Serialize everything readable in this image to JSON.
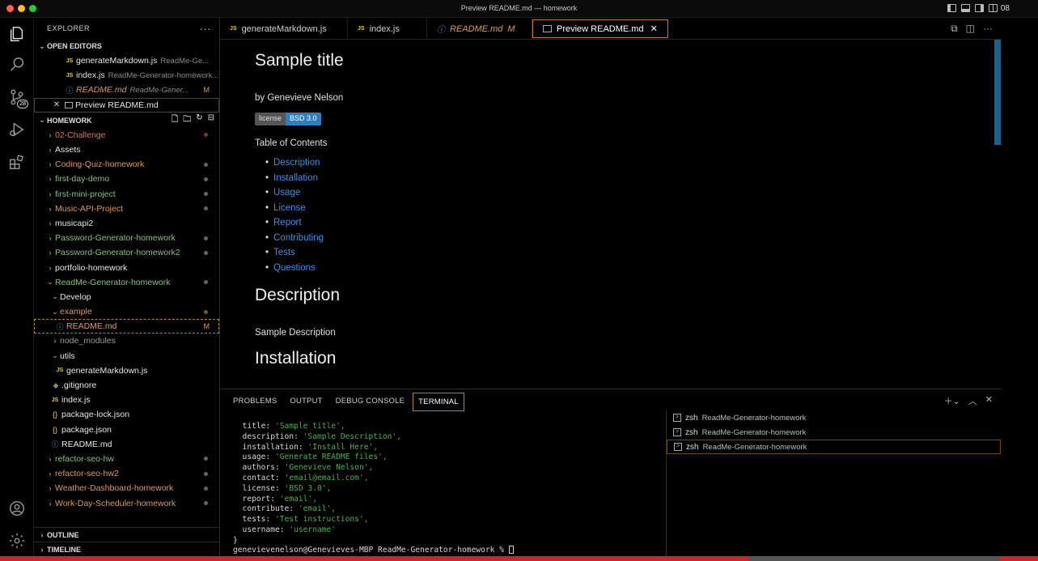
{
  "window": {
    "title": "Preview README.md — homework",
    "badge": "08"
  },
  "activity": {
    "scm_badge": "28"
  },
  "sidebar": {
    "header": "EXPLORER",
    "more": "···",
    "open_editors_label": "OPEN EDITORS",
    "open_editors": [
      {
        "name": "generateMarkdown.js",
        "desc": "ReadMe-Ge..."
      },
      {
        "name": "index.js",
        "desc": "ReadMe-Generator-homework..."
      },
      {
        "name": "README.md",
        "desc": "ReadMe-Gener...",
        "mod": "M"
      },
      {
        "name": "Preview README.md",
        "desc": ""
      }
    ],
    "workspace_label": "HOMEWORK",
    "tree": [
      "02-Challenge",
      "Assets",
      "Coding-Quiz-homework",
      "first-day-demo",
      "first-mini-project",
      "Music-API-Project",
      "musicapi2",
      "Password-Generator-homework",
      "Password-Generator-homework2",
      "portfolio-homework",
      "ReadMe-Generator-homework",
      "Develop",
      "example",
      "README.md",
      "node_modules",
      "utils",
      "generateMarkdown.js",
      ".gitignore",
      "index.js",
      "package-lock.json",
      "package.json",
      "README.md",
      "refactor-seo-hw",
      "refactor-seo-hw2",
      "Weather-Dashboard-homework",
      "Work-Day-Scheduler-homework"
    ],
    "readme_mod": "M",
    "outline_label": "OUTLINE",
    "timeline_label": "TIMELINE"
  },
  "tabs": [
    {
      "label": "generateMarkdown.js"
    },
    {
      "label": "index.js"
    },
    {
      "label": "README.md",
      "mod": "M"
    },
    {
      "label": "Preview README.md",
      "close": "✕"
    }
  ],
  "preview": {
    "title": "Sample title",
    "author": "by Genevieve Nelson",
    "badge_left": "license",
    "badge_right": "BSD 3.0",
    "toc_heading": "Table of Contents",
    "toc": [
      "Description",
      "Installation",
      "Usage",
      "License",
      "Report",
      "Contributing",
      "Tests",
      "Questions"
    ],
    "h_description": "Description",
    "p_description": "Sample Description",
    "h_installation": "Installation"
  },
  "panel": {
    "tabs": [
      "PROBLEMS",
      "OUTPUT",
      "DEBUG CONSOLE",
      "TERMINAL"
    ],
    "terminal_lines": [
      {
        "key": "  title: ",
        "val": "'Sample title',"
      },
      {
        "key": "  description: ",
        "val": "'Sample Description',"
      },
      {
        "key": "  installation: ",
        "val": "'Install Here',"
      },
      {
        "key": "  usage: ",
        "val": "'Generate README files',"
      },
      {
        "key": "  authors: ",
        "val": "'Genevieve Nelson',"
      },
      {
        "key": "  contact: ",
        "val": "'email@email.com',"
      },
      {
        "key": "  license: ",
        "val": "'BSD 3.0',"
      },
      {
        "key": "  report: ",
        "val": "'email',"
      },
      {
        "key": "  contribute: ",
        "val": "'email',"
      },
      {
        "key": "  tests: ",
        "val": "'Test instructions',"
      },
      {
        "key": "  username: ",
        "val": "'username'"
      }
    ],
    "closing_brace": "}",
    "prompt": "genevievenelson@Genevieves-MBP ReadMe-Generator-homework % ",
    "terminals": [
      {
        "shell": "zsh",
        "name": "ReadMe-Generator-homework"
      },
      {
        "shell": "zsh",
        "name": "ReadMe-Generator-homework"
      },
      {
        "shell": "zsh",
        "name": "ReadMe-Generator-homework"
      }
    ]
  }
}
